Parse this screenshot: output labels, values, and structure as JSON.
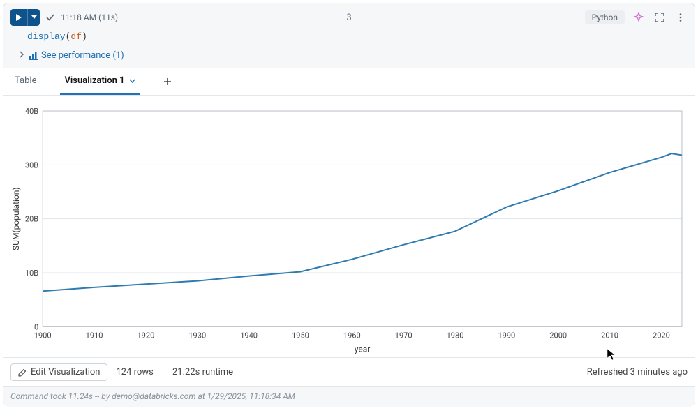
{
  "header": {
    "status_time": "11:18 AM (11s)",
    "cmd_number": "3",
    "language": "Python"
  },
  "code": {
    "fn": "display",
    "open": "(",
    "var": "df",
    "close": ")"
  },
  "perf": {
    "label": "See performance (1)"
  },
  "tabs": {
    "table": "Table",
    "viz": "Visualization 1"
  },
  "chart_data": {
    "type": "line",
    "xlabel": "year",
    "ylabel": "SUM(population)",
    "xlim": [
      1900,
      2024
    ],
    "ylim": [
      0,
      40
    ],
    "yunit": "B",
    "xticks": [
      1900,
      1910,
      1920,
      1930,
      1940,
      1950,
      1960,
      1970,
      1980,
      1990,
      2000,
      2010,
      2020
    ],
    "yticks": [
      0,
      10,
      20,
      30,
      40
    ],
    "series": [
      {
        "name": "SUM(population)",
        "x": [
          1900,
          1910,
          1920,
          1930,
          1940,
          1950,
          1960,
          1970,
          1980,
          1990,
          2000,
          2010,
          2020,
          2022,
          2024
        ],
        "values": [
          6.6,
          7.3,
          7.9,
          8.5,
          9.4,
          10.2,
          12.5,
          15.2,
          17.7,
          22.2,
          25.2,
          28.6,
          31.4,
          32.1,
          31.8
        ]
      }
    ]
  },
  "footer": {
    "edit": "Edit Visualization",
    "rows": "124 rows",
    "runtime": "21.22s runtime",
    "refreshed": "Refreshed 3 minutes ago"
  },
  "status": {
    "text": "Command took 11.24s -- by demo@databricks.com at 1/29/2025, 11:18:34 AM"
  }
}
